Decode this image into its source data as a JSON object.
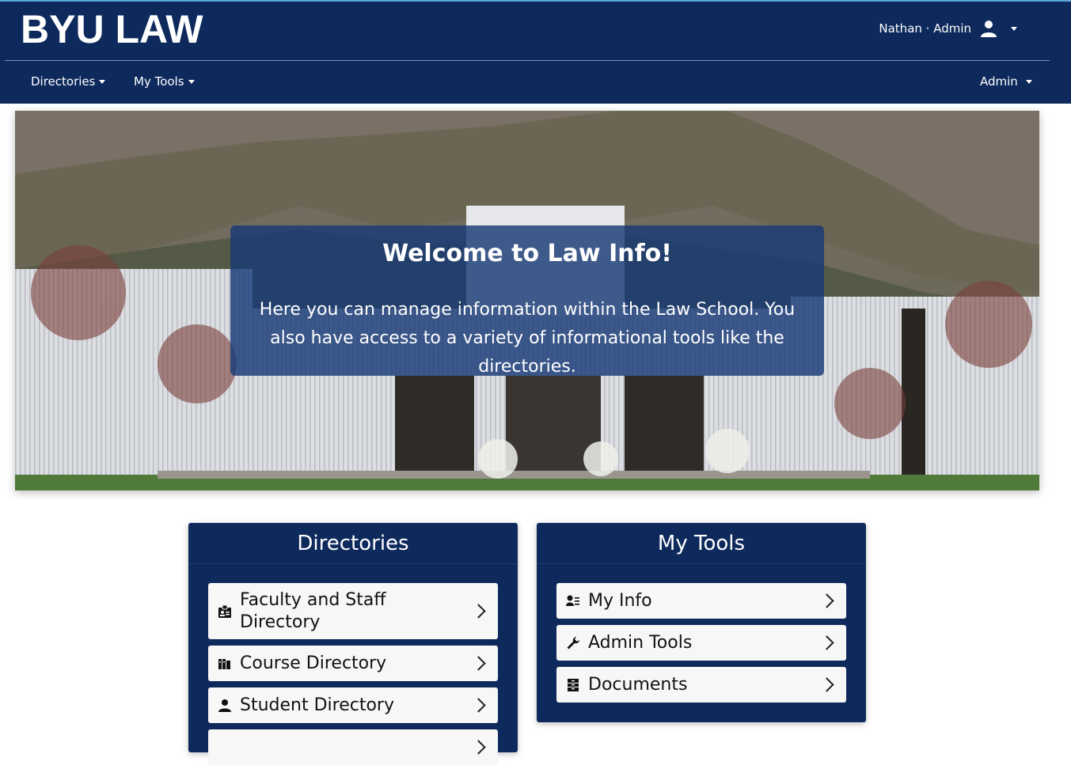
{
  "header": {
    "logo": "BYU LAW",
    "user_label": "Nathan · Admin"
  },
  "nav": {
    "directories": "Directories",
    "my_tools": "My Tools",
    "admin": "Admin"
  },
  "hero": {
    "title": "Welcome to Law Info!",
    "text": "Here you can manage information within the Law School. You also have access to a variety of informational tools like the directories."
  },
  "directories_card": {
    "title": "Directories",
    "items": [
      {
        "label": "Faculty and Staff Directory",
        "icon": "id-badge-icon"
      },
      {
        "label": "Course Directory",
        "icon": "books-icon"
      },
      {
        "label": "Student Directory",
        "icon": "person-icon"
      }
    ]
  },
  "tools_card": {
    "title": "My Tools",
    "items": [
      {
        "label": "My Info",
        "icon": "user-info-icon"
      },
      {
        "label": "Admin Tools",
        "icon": "wrench-icon"
      },
      {
        "label": "Documents",
        "icon": "file-cabinet-icon"
      }
    ]
  },
  "colors": {
    "brand_navy": "#0e2a5c",
    "welcome_overlay": "#183a76",
    "accent_line": "#5aa9d6"
  }
}
